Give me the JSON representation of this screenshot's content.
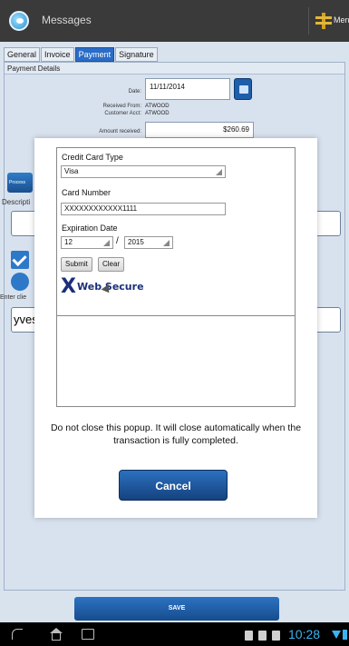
{
  "actionbar": {
    "title": "Messages",
    "menu_label": "Menu"
  },
  "tabs": [
    "General",
    "Invoice",
    "Payment",
    "Signature"
  ],
  "panel": {
    "header": "Payment Details",
    "date_label": "Date:",
    "date_value": "11/11/2014",
    "received_from_label": "Received From:",
    "received_from_value": "ATWOOD",
    "customer_acct_label": "Customer Acct:",
    "customer_acct_value": "ATWOOD",
    "amount_label": "Amount received:",
    "amount_value": "$260.69",
    "process_label": "Process",
    "description_label": "Descripti",
    "enter_label": "Enter clie",
    "client_value": "yves"
  },
  "popup": {
    "card_type_label": "Credit Card Type",
    "card_type_value": "Visa",
    "card_number_label": "Card Number",
    "card_number_value": "XXXXXXXXXXXX1111",
    "expiration_label": "Expiration Date",
    "exp_month": "12",
    "exp_sep": "/",
    "exp_year": "2015",
    "submit_label": "Submit",
    "clear_label": "Clear",
    "logo_x": "X",
    "logo_text": "Web Secure",
    "notice": "Do not close this popup. It will close automatically when the transaction is fully completed.",
    "cancel_label": "Cancel"
  },
  "save_label": "SAVE",
  "statusbar": {
    "time": "10:28"
  },
  "colors": {
    "accent": "#2a6cc7",
    "clock": "#3cb4f0",
    "button": "#1b4f8f"
  }
}
